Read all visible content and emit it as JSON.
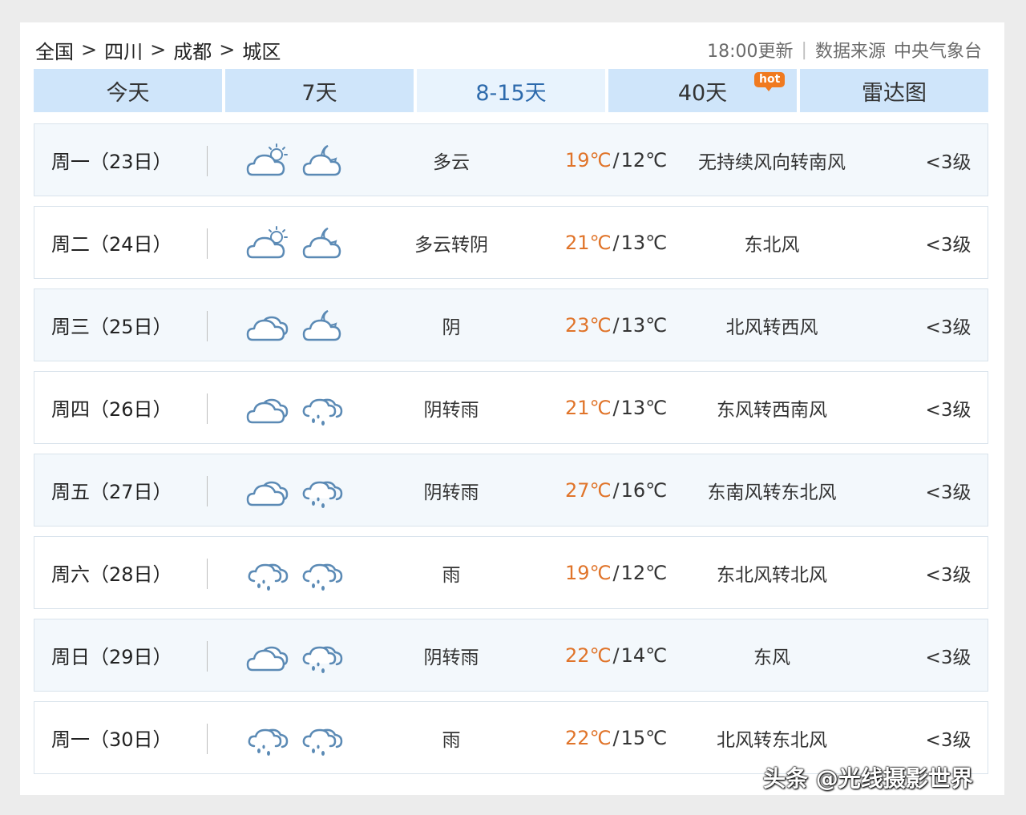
{
  "breadcrumb": [
    "全国",
    "四川",
    "成都",
    "城区"
  ],
  "breadcrumb_sep": ">",
  "meta": {
    "update_time": "18:00更新",
    "divider": "|",
    "source_label": "数据来源",
    "source_name": "中央气象台"
  },
  "tabs": [
    {
      "label": "今天",
      "active": false,
      "badge": ""
    },
    {
      "label": "7天",
      "active": false,
      "badge": ""
    },
    {
      "label": "8-15天",
      "active": true,
      "badge": ""
    },
    {
      "label": "40天",
      "active": false,
      "badge": "hot"
    },
    {
      "label": "雷达图",
      "active": false,
      "badge": ""
    }
  ],
  "colors": {
    "tab_bg": "#cfe5fa",
    "tab_active_bg": "#e8f3fd",
    "tab_active_text": "#2d6aac",
    "high_temp": "#e0742a",
    "hot_badge": "#f07a1f",
    "icon_stroke": "#5b8ab5"
  },
  "forecast": [
    {
      "date": "周一（23日）",
      "day_icon": "partly-cloudy-day-icon",
      "night_icon": "partly-cloudy-night-icon",
      "desc": "多云",
      "high": "19℃",
      "low": "12℃",
      "wind": "无持续风向转南风",
      "level": "<3级"
    },
    {
      "date": "周二（24日）",
      "day_icon": "partly-cloudy-day-icon",
      "night_icon": "partly-cloudy-night-icon",
      "desc": "多云转阴",
      "high": "21℃",
      "low": "13℃",
      "wind": "东北风",
      "level": "<3级"
    },
    {
      "date": "周三（25日）",
      "day_icon": "overcast-icon",
      "night_icon": "partly-cloudy-night-icon",
      "desc": "阴",
      "high": "23℃",
      "low": "13℃",
      "wind": "北风转西风",
      "level": "<3级"
    },
    {
      "date": "周四（26日）",
      "day_icon": "overcast-icon",
      "night_icon": "rain-icon",
      "desc": "阴转雨",
      "high": "21℃",
      "low": "13℃",
      "wind": "东风转西南风",
      "level": "<3级"
    },
    {
      "date": "周五（27日）",
      "day_icon": "overcast-icon",
      "night_icon": "rain-icon",
      "desc": "阴转雨",
      "high": "27℃",
      "low": "16℃",
      "wind": "东南风转东北风",
      "level": "<3级"
    },
    {
      "date": "周六（28日）",
      "day_icon": "rain-icon",
      "night_icon": "rain-icon",
      "desc": "雨",
      "high": "19℃",
      "low": "12℃",
      "wind": "东北风转北风",
      "level": "<3级"
    },
    {
      "date": "周日（29日）",
      "day_icon": "overcast-icon",
      "night_icon": "rain-icon",
      "desc": "阴转雨",
      "high": "22℃",
      "low": "14℃",
      "wind": "东风",
      "level": "<3级"
    },
    {
      "date": "周一（30日）",
      "day_icon": "rain-icon",
      "night_icon": "rain-icon",
      "desc": "雨",
      "high": "22℃",
      "low": "15℃",
      "wind": "北风转东北风",
      "level": "<3级"
    }
  ],
  "temp_sep": "/",
  "watermark": "头条 @光线摄影世界"
}
